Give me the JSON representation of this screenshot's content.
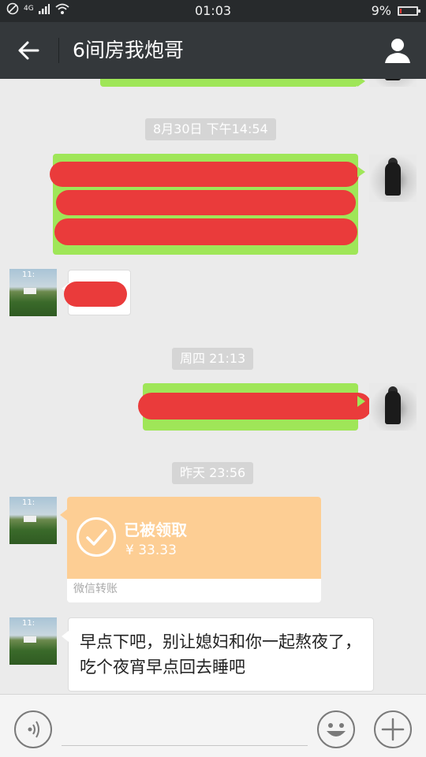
{
  "status_bar": {
    "network": "4G",
    "time": "01:03",
    "battery_percent": "9%",
    "battery_level": 0.09,
    "battery_color": "#e53935"
  },
  "header": {
    "title": "6间房我炮哥",
    "back_icon": "back-arrow-icon",
    "profile_icon": "person-icon"
  },
  "timestamps": [
    "8月30日 下午14:54",
    "周四 21:13",
    "昨天 23:56"
  ],
  "transfer": {
    "status": "已被领取",
    "amount": "¥ 33.33",
    "label": "微信转账",
    "card_color": "#fdce94"
  },
  "last_message": {
    "text": "早点下吧，别让媳妇和你一起熬夜了，吃个夜宵早点回去睡吧"
  },
  "input_bar": {
    "voice_icon": "voice-icon",
    "emoji_icon": "emoji-icon",
    "more_icon": "plus-icon"
  },
  "colors": {
    "header_bg": "#34383b",
    "chat_bg": "#ebebeb",
    "outgoing_bubble": "#9fe658",
    "redaction": "#ea3b3b"
  }
}
